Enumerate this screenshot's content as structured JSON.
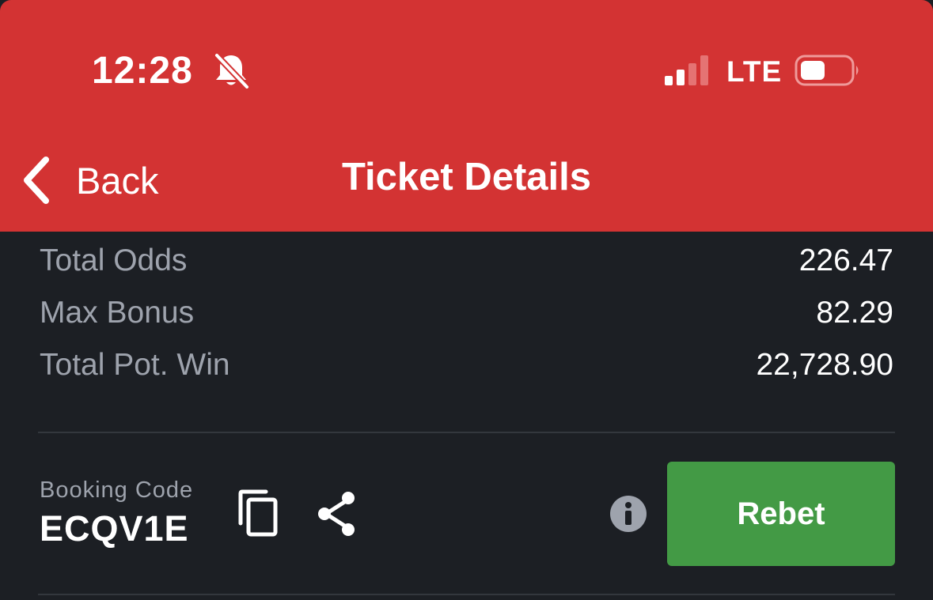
{
  "status_bar": {
    "time": "12:28",
    "network": "LTE",
    "icons": [
      "bell-slash-icon",
      "signal-icon",
      "battery-icon"
    ]
  },
  "nav": {
    "back_label": "Back",
    "title": "Ticket Details"
  },
  "summary": [
    {
      "label": "Total Odds",
      "value": "226.47"
    },
    {
      "label": "Max Bonus",
      "value": "82.29"
    },
    {
      "label": "Total Pot. Win",
      "value": "22,728.90"
    }
  ],
  "booking": {
    "caption": "Booking Code",
    "code": "ECQV1E",
    "actions": [
      "copy-icon",
      "share-icon",
      "info-icon"
    ]
  },
  "rebet_label": "Rebet",
  "colors": {
    "header": "#d33333",
    "background": "#1c1f24",
    "muted_text": "#9ea3ad",
    "rebet_button": "#439a45",
    "divider": "#33373d"
  }
}
